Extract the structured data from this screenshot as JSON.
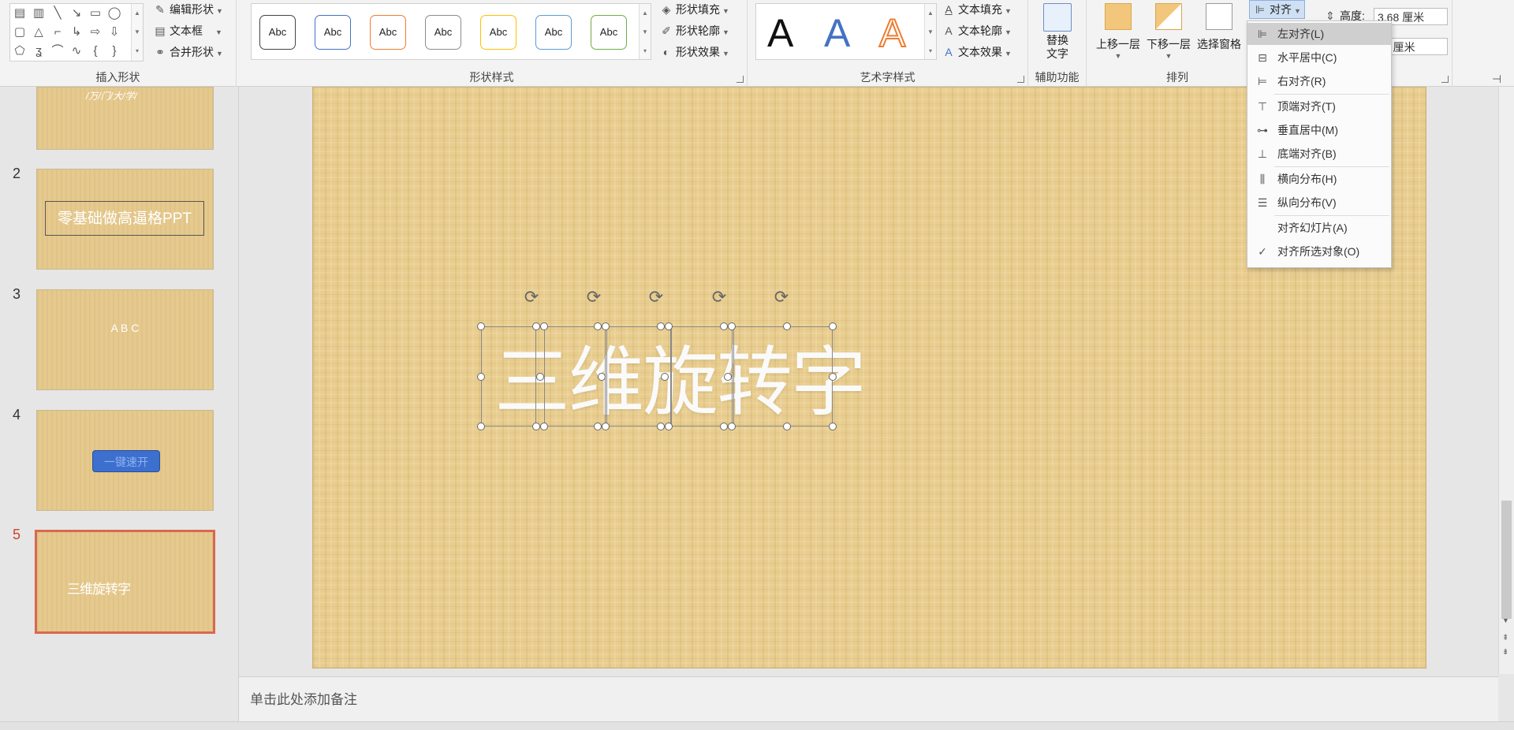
{
  "ribbon": {
    "insert_shapes": {
      "label": "插入形状",
      "edit_shape": "编辑形状",
      "text_box": "文本框",
      "merge_shapes": "合并形状"
    },
    "shape_styles": {
      "label": "形状样式",
      "samples": [
        "Abc",
        "Abc",
        "Abc",
        "Abc",
        "Abc",
        "Abc",
        "Abc"
      ],
      "colors": [
        "#333333",
        "#4472c4",
        "#ed7d31",
        "#8c8c8c",
        "#ffc000",
        "#5b9bd5",
        "#70ad47"
      ],
      "fill": "形状填充",
      "outline": "形状轮廓",
      "effects": "形状效果"
    },
    "wordart_styles": {
      "label": "艺术字样式",
      "samples": [
        "A",
        "A",
        "A"
      ],
      "text_fill": "文本填充",
      "text_outline": "文本轮廓",
      "text_effects": "文本效果"
    },
    "accessibility": {
      "label": "辅助功能",
      "alt_text_line1": "替换",
      "alt_text_line2": "文字"
    },
    "arrange": {
      "label": "排列",
      "bring_forward": "上移一层",
      "send_backward": "下移一层",
      "selection_pane": "选择窗格",
      "align": "对齐"
    },
    "size": {
      "height_label": "高度:",
      "height_value": "3.68 厘米",
      "width_value": "36 厘米"
    }
  },
  "align_menu": {
    "items": [
      {
        "label": "左对齐(L)",
        "icon": "align-left-icon",
        "active": true
      },
      {
        "label": "水平居中(C)",
        "icon": "align-center-icon"
      },
      {
        "label": "右对齐(R)",
        "icon": "align-right-icon"
      },
      {
        "label": "顶端对齐(T)",
        "icon": "align-top-icon"
      },
      {
        "label": "垂直居中(M)",
        "icon": "align-middle-icon"
      },
      {
        "label": "底端对齐(B)",
        "icon": "align-bottom-icon"
      },
      {
        "label": "横向分布(H)",
        "icon": "distribute-horizontal-icon"
      },
      {
        "label": "纵向分布(V)",
        "icon": "distribute-vertical-icon"
      },
      {
        "label": "对齐幻灯片(A)",
        "icon": ""
      },
      {
        "label": "对齐所选对象(O)",
        "icon": "check-icon",
        "checked": true
      }
    ]
  },
  "slides": {
    "thumbnails": [
      {
        "number": "",
        "text": "/万/门/大/学/"
      },
      {
        "number": "2",
        "text": "零基础做高逼格PPT"
      },
      {
        "number": "3",
        "text": "A B C"
      },
      {
        "number": "4",
        "text": "一键速开"
      },
      {
        "number": "5",
        "text": "三维旋转字",
        "selected": true
      }
    ],
    "current_slide_text": "三维旋转字"
  },
  "notes": {
    "placeholder": "单击此处添加备注"
  },
  "colors": {
    "slide_bg": "#e9cd8e",
    "selected_thumb_border": "#d9534f",
    "menu_active": "#cfcfcf"
  }
}
